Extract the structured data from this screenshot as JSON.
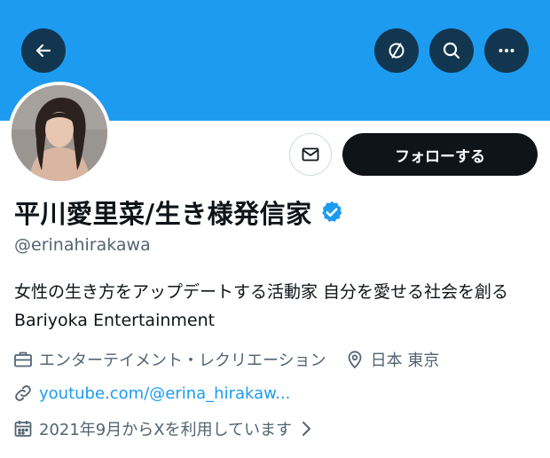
{
  "header": {
    "back_icon": "arrow-left-icon",
    "actions": [
      "hide-icon",
      "search-icon",
      "more-icon"
    ]
  },
  "profile": {
    "name": "平川愛里菜/生き様発信家",
    "handle": "@erinahirakawa",
    "verified": true,
    "bio": "女性の生き方をアップデートする活動家 自分を愛せる社会を創る Bariyoka Entertainment",
    "category": "エンターテイメント・レクリエーション",
    "location": "日本 東京",
    "link": "youtube.com/@erina_hirakaw...",
    "joined": "2021年9月からXを利用しています"
  },
  "actions": {
    "follow_label": "フォローする",
    "message_icon": "envelope-icon"
  },
  "colors": {
    "banner": "#1d9bf0",
    "accent": "#1d9bf0",
    "follow_bg": "#0f1419",
    "muted_text": "#536471"
  }
}
